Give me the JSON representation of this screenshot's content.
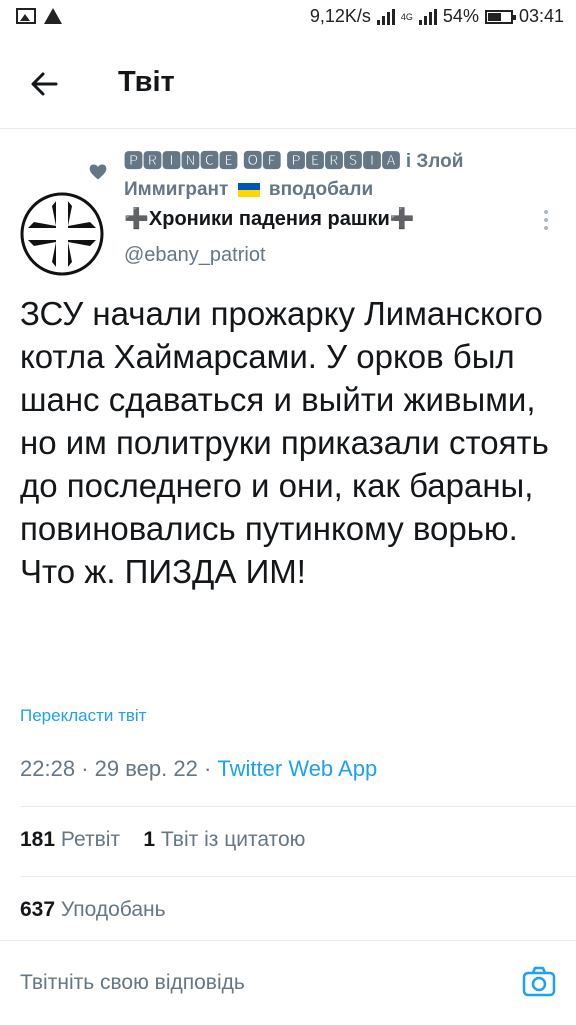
{
  "status_bar": {
    "speed": "9,12K/s",
    "network": "4G",
    "battery": "54%",
    "time": "03:41"
  },
  "header": {
    "title": "Твіт"
  },
  "liked_by": {
    "text_1": "🅿🆁🅸🅽🅲🅴 🅾🅵 🅿🅴🆁🆂🅸🅰 і Злой Иммигрант",
    "text_2": "вподобали"
  },
  "author": {
    "name": "➕Хроники падения рашки➕",
    "handle": "@ebany_patriot"
  },
  "tweet": {
    "text": "ЗСУ начали прожарку Лиманского котла Хаймарсами. У орков был шанс сдаваться и выйти живыми, но им политруки приказали стоять до последнего и они, как бараны, повиновались путинкому ворью.\nЧто ж. ПИЗДА ИМ!",
    "translate_label": "Перекласти твіт",
    "time": "22:28",
    "date": "29 вер. 22",
    "source": "Twitter Web App"
  },
  "stats": {
    "retweets_count": "181",
    "retweets_label": "Ретвіт",
    "quotes_count": "1",
    "quotes_label": "Твіт із цитатою",
    "likes_count": "637",
    "likes_label": "Уподобань"
  },
  "reply": {
    "placeholder": "Твітніть свою відповідь"
  },
  "colors": {
    "accent": "#1da1f2",
    "secondary_text": "#657786",
    "divider": "#e6ecf0"
  },
  "icons": [
    "image-icon",
    "warning-icon",
    "signal-icon",
    "battery-icon",
    "back-arrow-icon",
    "heart-icon",
    "ukraine-flag-icon",
    "more-vertical-icon",
    "camera-icon"
  ]
}
